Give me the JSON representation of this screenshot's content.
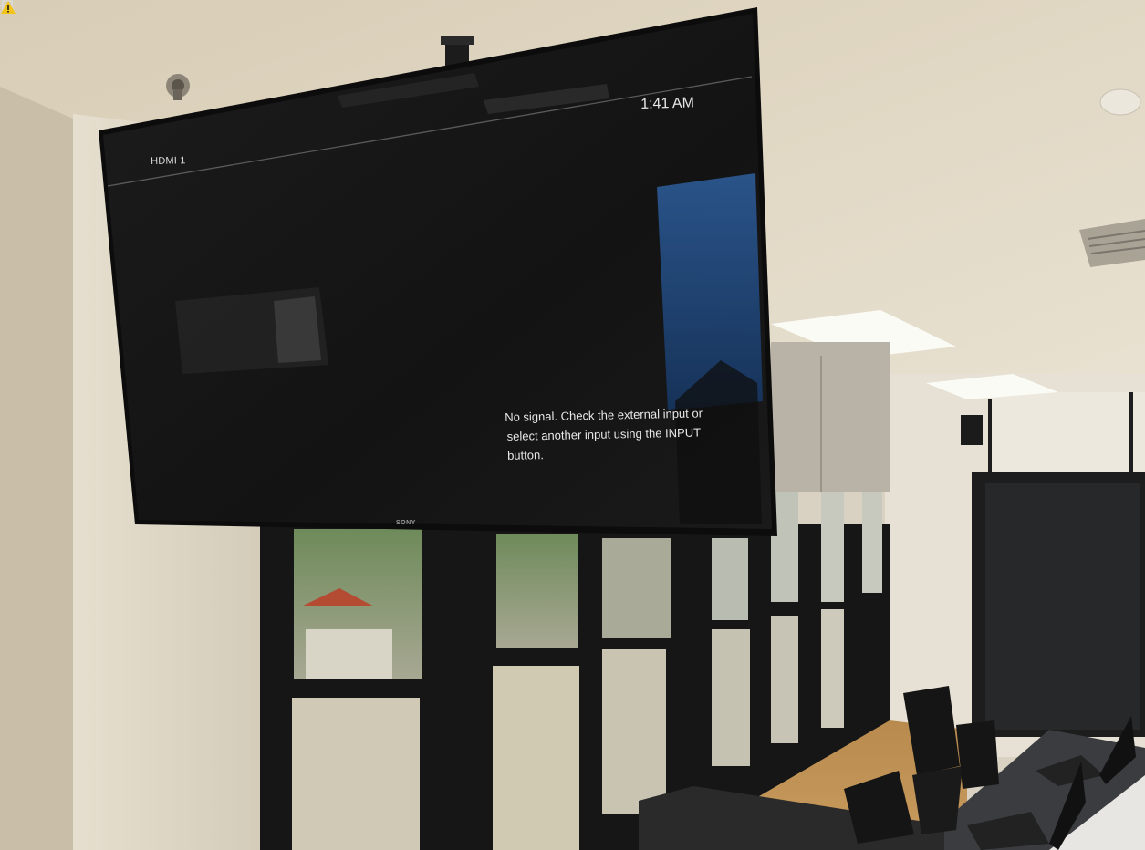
{
  "tv": {
    "input_label": "HDMI 1",
    "input_icon": "input-source-icon",
    "clock": "1:41 AM",
    "warning_icon": "warning-triangle-icon",
    "message_lines": [
      "No signal. Check the external input or",
      "select another input using the INPUT",
      "button."
    ],
    "brand": "SONY",
    "screen_color": "#161616",
    "warning_color": "#f2c318"
  }
}
